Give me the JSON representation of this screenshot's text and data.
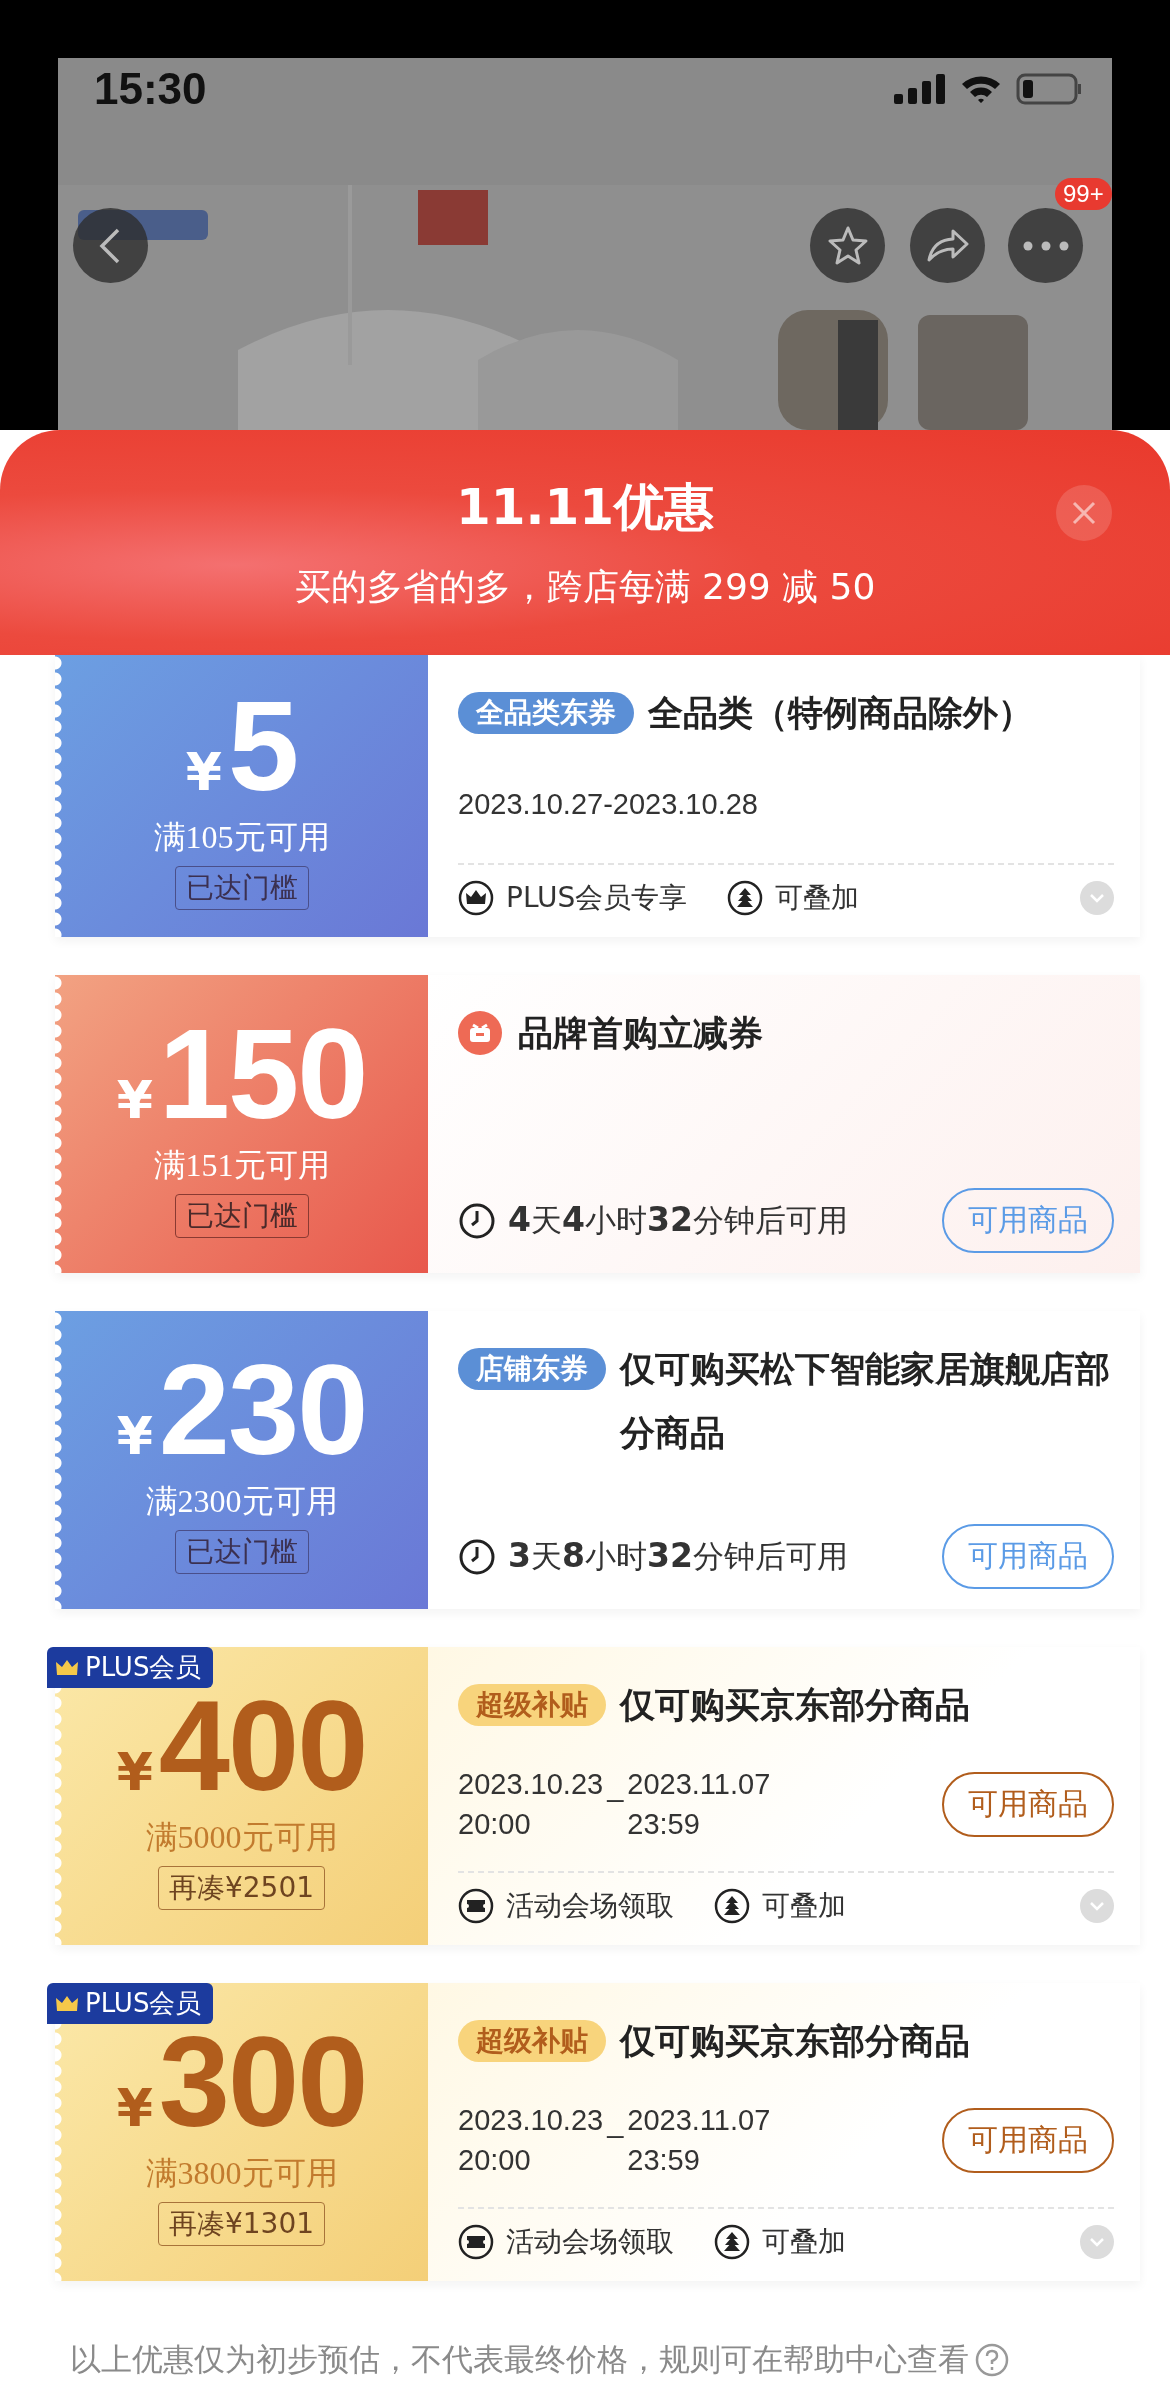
{
  "status_bar": {
    "time": "15:30"
  },
  "product_header": {
    "more_badge": "99+"
  },
  "sheet": {
    "title": "11.11优惠",
    "subtitle": "买的多省的多，跨店每满 299 减 50"
  },
  "coupons": [
    {
      "kind": "blue",
      "currency": "¥",
      "amount": "5",
      "condition": "满105元可用",
      "threshold": "已达门槛",
      "tag": "全品类东券",
      "title": "全品类（特例商品除外）",
      "validity": {
        "kind": "range",
        "text": "2023.10.27-2023.10.28"
      },
      "features": [
        {
          "kind": "crown",
          "text": "PLUS会员专享"
        },
        {
          "kind": "stack",
          "text": "可叠加"
        }
      ],
      "expandable": true
    },
    {
      "kind": "brand",
      "currency": "¥",
      "amount": "150",
      "condition": "满151元可用",
      "threshold": "已达门槛",
      "title": "品牌首购立减券",
      "validity": {
        "kind": "countdown",
        "text": "**4**天**4**小时**32**分钟后可用"
      },
      "action": "可用商品",
      "expandable": false
    },
    {
      "kind": "blue",
      "currency": "¥",
      "amount": "230",
      "condition": "满2300元可用",
      "threshold": "已达门槛",
      "tag": "店铺东券",
      "title": "仅可购买松下智能家居旗舰店部分商品",
      "validity": {
        "kind": "countdown",
        "text": "**3**天**8**小时**32**分钟后可用"
      },
      "action": "可用商品",
      "expandable": false
    },
    {
      "kind": "gold",
      "plus_badge": "PLUS会员",
      "currency": "¥",
      "amount": "400",
      "condition": "满5000元可用",
      "threshold": "再凑¥2501",
      "tag": "超级补贴",
      "title": "仅可购买京东部分商品",
      "validity": {
        "kind": "split",
        "start_date": "2023.10.23",
        "start_time": "20:00",
        "separator": "_",
        "end_date": "2023.11.07",
        "end_time": "23:59"
      },
      "action": "可用商品",
      "features": [
        {
          "kind": "ticket",
          "text": "活动会场领取"
        },
        {
          "kind": "stack",
          "text": "可叠加"
        }
      ],
      "expandable": true
    },
    {
      "kind": "gold",
      "plus_badge": "PLUS会员",
      "currency": "¥",
      "amount": "300",
      "condition": "满3800元可用",
      "threshold": "再凑¥1301",
      "tag": "超级补贴",
      "title": "仅可购买京东部分商品",
      "validity": {
        "kind": "split",
        "start_date": "2023.10.23",
        "start_time": "20:00",
        "separator": "_",
        "end_date": "2023.11.07",
        "end_time": "23:59"
      },
      "action": "可用商品",
      "features": [
        {
          "kind": "ticket",
          "text": "活动会场领取"
        },
        {
          "kind": "stack",
          "text": "可叠加"
        }
      ],
      "expandable": true
    }
  ],
  "footer": {
    "note": "以上优惠仅为初步预估，不代表最终价格，规则可在帮助中心查看"
  }
}
